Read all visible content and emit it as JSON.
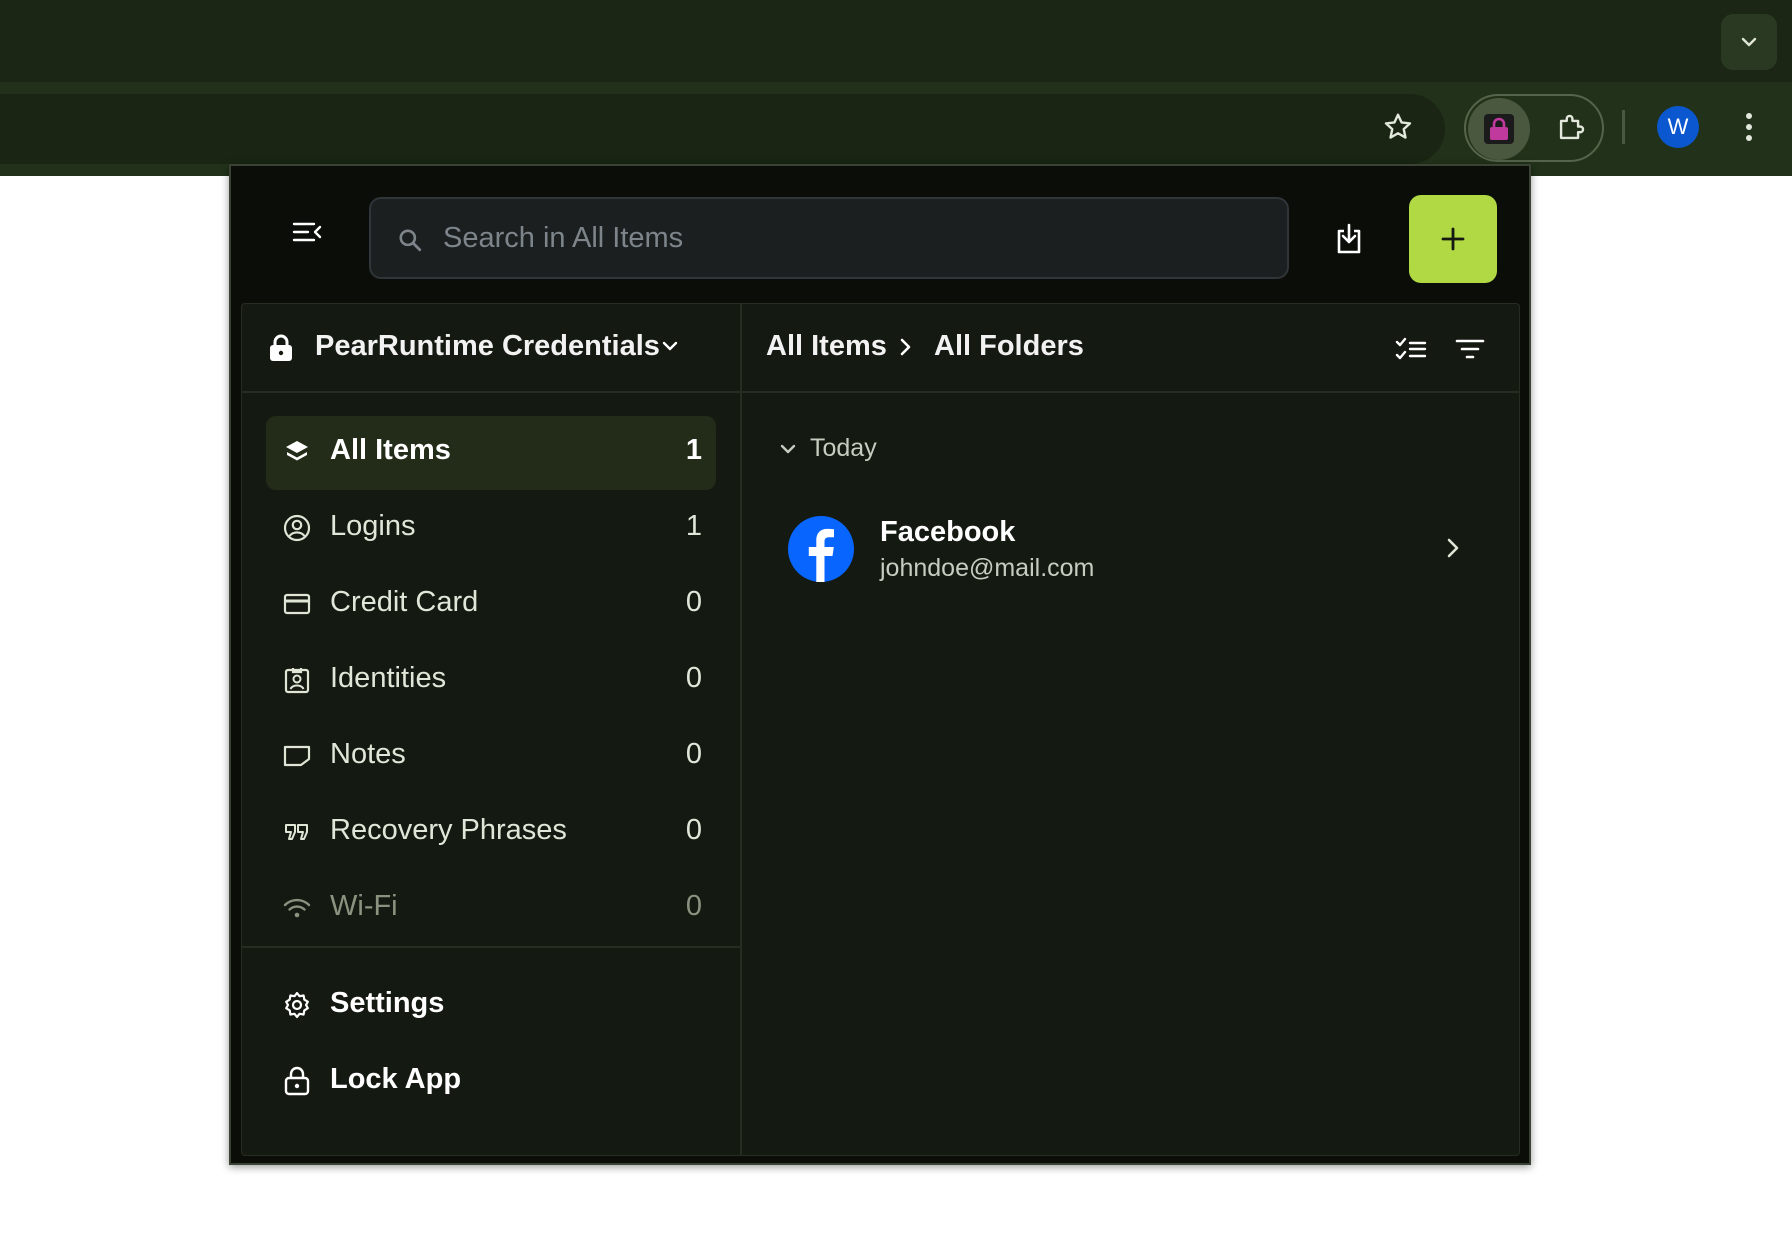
{
  "browser": {
    "avatar_letter": "W"
  },
  "popup": {
    "search": {
      "placeholder": "Search in All Items",
      "value": ""
    },
    "vault": {
      "name": "PearRuntime Credentials"
    },
    "nav": [
      {
        "label": "All Items",
        "count": "1",
        "icon": "layers-icon",
        "active": true
      },
      {
        "label": "Logins",
        "count": "1",
        "icon": "user-circle-icon"
      },
      {
        "label": "Credit Card",
        "count": "0",
        "icon": "credit-card-icon"
      },
      {
        "label": "Identities",
        "count": "0",
        "icon": "id-badge-icon"
      },
      {
        "label": "Notes",
        "count": "0",
        "icon": "note-icon"
      },
      {
        "label": "Recovery Phrases",
        "count": "0",
        "icon": "quote-icon"
      },
      {
        "label": "Wi-Fi",
        "count": "0",
        "icon": "wifi-icon"
      }
    ],
    "bottom_nav": [
      {
        "label": "Settings",
        "icon": "gear-icon"
      },
      {
        "label": "Lock App",
        "icon": "lock-icon"
      }
    ],
    "breadcrumb": [
      "All Items",
      "All Folders"
    ],
    "group": {
      "label": "Today"
    },
    "items": [
      {
        "title": "Facebook",
        "subtitle": "johndoe@mail.com",
        "icon": "facebook-icon"
      }
    ]
  },
  "colors": {
    "accent": "#b0d944",
    "popup_bg": "#0b0d09",
    "panel_bg": "#141911",
    "active_item_bg": "#232c18",
    "browser_bg": "#1b2614",
    "facebook_blue": "#0866ff"
  }
}
